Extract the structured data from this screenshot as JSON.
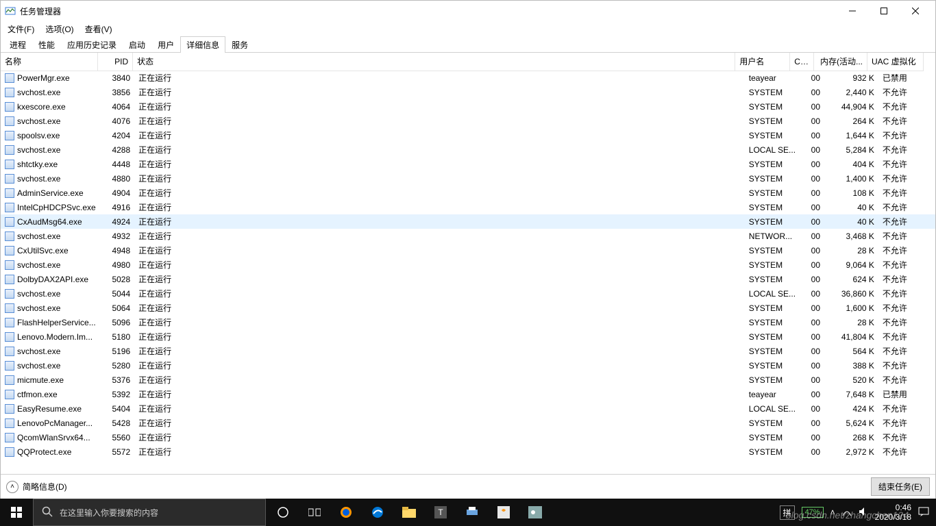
{
  "window": {
    "title": "任务管理器",
    "menu": [
      "文件(F)",
      "选项(O)",
      "查看(V)"
    ],
    "tabs": [
      "进程",
      "性能",
      "应用历史记录",
      "启动",
      "用户",
      "详细信息",
      "服务"
    ],
    "active_tab": 5
  },
  "columns": {
    "name": "名称",
    "pid": "PID",
    "status": "状态",
    "user": "用户名",
    "cpu": "CPU",
    "mem": "内存(活动...",
    "uac": "UAC 虚拟化"
  },
  "rows": [
    {
      "name": "PowerMgr.exe",
      "pid": "3840",
      "status": "正在运行",
      "user": "teayear",
      "cpu": "00",
      "mem": "932 K",
      "uac": "已禁用"
    },
    {
      "name": "svchost.exe",
      "pid": "3856",
      "status": "正在运行",
      "user": "SYSTEM",
      "cpu": "00",
      "mem": "2,440 K",
      "uac": "不允许"
    },
    {
      "name": "kxescore.exe",
      "pid": "4064",
      "status": "正在运行",
      "user": "SYSTEM",
      "cpu": "00",
      "mem": "44,904 K",
      "uac": "不允许"
    },
    {
      "name": "svchost.exe",
      "pid": "4076",
      "status": "正在运行",
      "user": "SYSTEM",
      "cpu": "00",
      "mem": "264 K",
      "uac": "不允许"
    },
    {
      "name": "spoolsv.exe",
      "pid": "4204",
      "status": "正在运行",
      "user": "SYSTEM",
      "cpu": "00",
      "mem": "1,644 K",
      "uac": "不允许"
    },
    {
      "name": "svchost.exe",
      "pid": "4288",
      "status": "正在运行",
      "user": "LOCAL SE...",
      "cpu": "00",
      "mem": "5,284 K",
      "uac": "不允许"
    },
    {
      "name": "shtctky.exe",
      "pid": "4448",
      "status": "正在运行",
      "user": "SYSTEM",
      "cpu": "00",
      "mem": "404 K",
      "uac": "不允许"
    },
    {
      "name": "svchost.exe",
      "pid": "4880",
      "status": "正在运行",
      "user": "SYSTEM",
      "cpu": "00",
      "mem": "1,400 K",
      "uac": "不允许"
    },
    {
      "name": "AdminService.exe",
      "pid": "4904",
      "status": "正在运行",
      "user": "SYSTEM",
      "cpu": "00",
      "mem": "108 K",
      "uac": "不允许"
    },
    {
      "name": "IntelCpHDCPSvc.exe",
      "pid": "4916",
      "status": "正在运行",
      "user": "SYSTEM",
      "cpu": "00",
      "mem": "40 K",
      "uac": "不允许"
    },
    {
      "name": "CxAudMsg64.exe",
      "pid": "4924",
      "status": "正在运行",
      "user": "SYSTEM",
      "cpu": "00",
      "mem": "40 K",
      "uac": "不允许",
      "hover": true
    },
    {
      "name": "svchost.exe",
      "pid": "4932",
      "status": "正在运行",
      "user": "NETWOR...",
      "cpu": "00",
      "mem": "3,468 K",
      "uac": "不允许"
    },
    {
      "name": "CxUtilSvc.exe",
      "pid": "4948",
      "status": "正在运行",
      "user": "SYSTEM",
      "cpu": "00",
      "mem": "28 K",
      "uac": "不允许"
    },
    {
      "name": "svchost.exe",
      "pid": "4980",
      "status": "正在运行",
      "user": "SYSTEM",
      "cpu": "00",
      "mem": "9,064 K",
      "uac": "不允许"
    },
    {
      "name": "DolbyDAX2API.exe",
      "pid": "5028",
      "status": "正在运行",
      "user": "SYSTEM",
      "cpu": "00",
      "mem": "624 K",
      "uac": "不允许"
    },
    {
      "name": "svchost.exe",
      "pid": "5044",
      "status": "正在运行",
      "user": "LOCAL SE...",
      "cpu": "00",
      "mem": "36,860 K",
      "uac": "不允许"
    },
    {
      "name": "svchost.exe",
      "pid": "5064",
      "status": "正在运行",
      "user": "SYSTEM",
      "cpu": "00",
      "mem": "1,600 K",
      "uac": "不允许"
    },
    {
      "name": "FlashHelperService...",
      "pid": "5096",
      "status": "正在运行",
      "user": "SYSTEM",
      "cpu": "00",
      "mem": "28 K",
      "uac": "不允许"
    },
    {
      "name": "Lenovo.Modern.Im...",
      "pid": "5180",
      "status": "正在运行",
      "user": "SYSTEM",
      "cpu": "00",
      "mem": "41,804 K",
      "uac": "不允许"
    },
    {
      "name": "svchost.exe",
      "pid": "5196",
      "status": "正在运行",
      "user": "SYSTEM",
      "cpu": "00",
      "mem": "564 K",
      "uac": "不允许"
    },
    {
      "name": "svchost.exe",
      "pid": "5280",
      "status": "正在运行",
      "user": "SYSTEM",
      "cpu": "00",
      "mem": "388 K",
      "uac": "不允许"
    },
    {
      "name": "micmute.exe",
      "pid": "5376",
      "status": "正在运行",
      "user": "SYSTEM",
      "cpu": "00",
      "mem": "520 K",
      "uac": "不允许"
    },
    {
      "name": "ctfmon.exe",
      "pid": "5392",
      "status": "正在运行",
      "user": "teayear",
      "cpu": "00",
      "mem": "7,648 K",
      "uac": "已禁用"
    },
    {
      "name": "EasyResume.exe",
      "pid": "5404",
      "status": "正在运行",
      "user": "LOCAL SE...",
      "cpu": "00",
      "mem": "424 K",
      "uac": "不允许"
    },
    {
      "name": "LenovoPcManager...",
      "pid": "5428",
      "status": "正在运行",
      "user": "SYSTEM",
      "cpu": "00",
      "mem": "5,624 K",
      "uac": "不允许"
    },
    {
      "name": "QcomWlanSrvx64...",
      "pid": "5560",
      "status": "正在运行",
      "user": "SYSTEM",
      "cpu": "00",
      "mem": "268 K",
      "uac": "不允许"
    },
    {
      "name": "QQProtect.exe",
      "pid": "5572",
      "status": "正在运行",
      "user": "SYSTEM",
      "cpu": "00",
      "mem": "2,972 K",
      "uac": "不允许"
    }
  ],
  "footer": {
    "fewer": "简略信息(D)",
    "end_task": "结束任务(E)"
  },
  "taskbar": {
    "search_placeholder": "在这里输入你要搜索的内容",
    "ime": "拼",
    "battery": "47%",
    "time": "0:46",
    "date": "2020/3/18"
  },
  "watermark": "blog.csdn.net/zhangchen124"
}
